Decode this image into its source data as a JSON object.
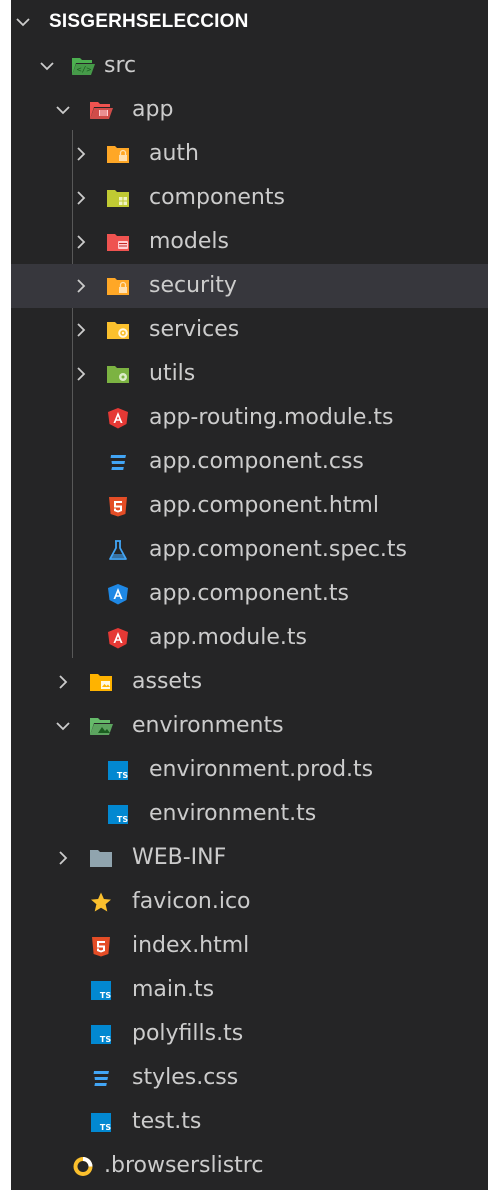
{
  "explorer": {
    "root_label": "SISGERHSELECCION",
    "items": [
      {
        "label": "src",
        "depth": 1,
        "type": "folder",
        "expanded": true,
        "icon": "folder-src-open-icon",
        "color": "#4caf50"
      },
      {
        "label": "app",
        "depth": 2,
        "type": "folder",
        "expanded": true,
        "icon": "folder-app-open-icon",
        "color": "#ef5350"
      },
      {
        "label": "auth",
        "depth": 3,
        "type": "folder",
        "expanded": false,
        "icon": "folder-auth-icon",
        "color": "#ffa726"
      },
      {
        "label": "components",
        "depth": 3,
        "type": "folder",
        "expanded": false,
        "icon": "folder-components-icon",
        "color": "#c0ca33"
      },
      {
        "label": "models",
        "depth": 3,
        "type": "folder",
        "expanded": false,
        "icon": "folder-models-icon",
        "color": "#ef5350"
      },
      {
        "label": "security",
        "depth": 3,
        "type": "folder",
        "expanded": false,
        "icon": "folder-security-icon",
        "color": "#ffa726",
        "selected": true
      },
      {
        "label": "services",
        "depth": 3,
        "type": "folder",
        "expanded": false,
        "icon": "folder-services-icon",
        "color": "#fbc02d"
      },
      {
        "label": "utils",
        "depth": 3,
        "type": "folder",
        "expanded": false,
        "icon": "folder-utils-icon",
        "color": "#7cb342"
      },
      {
        "label": "app-routing.module.ts",
        "depth": 3,
        "type": "file",
        "icon": "angular-icon",
        "color": "#e53935"
      },
      {
        "label": "app.component.css",
        "depth": 3,
        "type": "file",
        "icon": "css-icon",
        "color": "#42a5f5"
      },
      {
        "label": "app.component.html",
        "depth": 3,
        "type": "file",
        "icon": "html-icon",
        "color": "#e44d26"
      },
      {
        "label": "app.component.spec.ts",
        "depth": 3,
        "type": "file",
        "icon": "test-flask-icon",
        "color": "#42a5f5"
      },
      {
        "label": "app.component.ts",
        "depth": 3,
        "type": "file",
        "icon": "angular-component-icon",
        "color": "#1e88e5"
      },
      {
        "label": "app.module.ts",
        "depth": 3,
        "type": "file",
        "icon": "angular-icon",
        "color": "#e53935"
      },
      {
        "label": "assets",
        "depth": 2,
        "type": "folder",
        "expanded": false,
        "icon": "folder-assets-icon",
        "color": "#ffb300"
      },
      {
        "label": "environments",
        "depth": 2,
        "type": "folder",
        "expanded": true,
        "icon": "folder-environments-open-icon",
        "color": "#66bb6a"
      },
      {
        "label": "environment.prod.ts",
        "depth": 3,
        "type": "file",
        "icon": "typescript-icon",
        "color": "#0288d1"
      },
      {
        "label": "environment.ts",
        "depth": 3,
        "type": "file",
        "icon": "typescript-icon",
        "color": "#0288d1"
      },
      {
        "label": "WEB-INF",
        "depth": 2,
        "type": "folder",
        "expanded": false,
        "icon": "folder-icon",
        "color": "#90a4ae"
      },
      {
        "label": "favicon.ico",
        "depth": 2,
        "type": "file",
        "icon": "star-icon",
        "color": "#fbc02d"
      },
      {
        "label": "index.html",
        "depth": 2,
        "type": "file",
        "icon": "html-icon",
        "color": "#e44d26"
      },
      {
        "label": "main.ts",
        "depth": 2,
        "type": "file",
        "icon": "typescript-icon",
        "color": "#0288d1"
      },
      {
        "label": "polyfills.ts",
        "depth": 2,
        "type": "file",
        "icon": "typescript-icon",
        "color": "#0288d1"
      },
      {
        "label": "styles.css",
        "depth": 2,
        "type": "file",
        "icon": "css-icon",
        "color": "#42a5f5"
      },
      {
        "label": "test.ts",
        "depth": 2,
        "type": "file",
        "icon": "typescript-icon",
        "color": "#0288d1"
      },
      {
        "label": ".browserslistrc",
        "depth": 1,
        "type": "file",
        "icon": "browserslist-icon",
        "color": "#fbc02d"
      }
    ]
  }
}
